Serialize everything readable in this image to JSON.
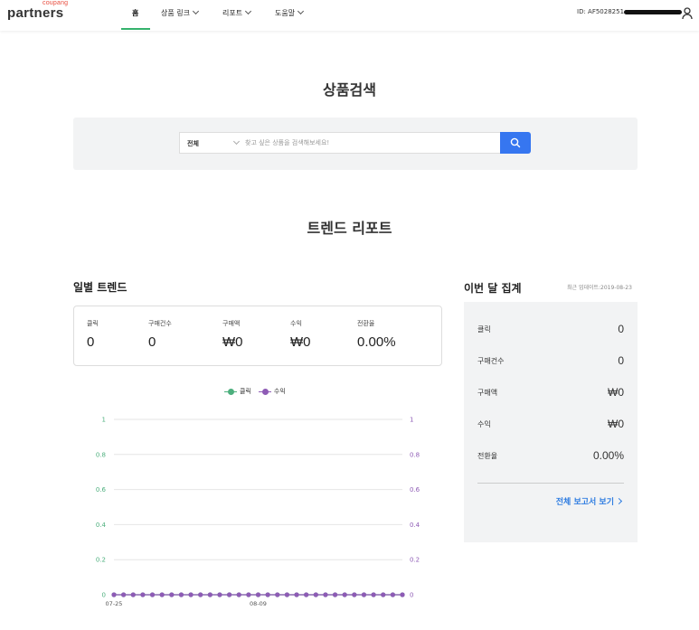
{
  "header": {
    "logo_small": "coupang",
    "logo_main": "partners",
    "nav": [
      {
        "label": "홈"
      },
      {
        "label": "상품 링크"
      },
      {
        "label": "리포트"
      },
      {
        "label": "도움말"
      }
    ],
    "user_id": "ID: AF5028251"
  },
  "search_section": {
    "title": "상품검색",
    "category": "전체",
    "placeholder": "찾고 싶은 상품을 검색해보세요!"
  },
  "trend_section": {
    "title": "트렌드 리포트"
  },
  "daily": {
    "title": "일별 트렌드",
    "stats": [
      {
        "label": "클릭",
        "value": "0"
      },
      {
        "label": "구매건수",
        "value": "0"
      },
      {
        "label": "구매액",
        "value": "₩0"
      },
      {
        "label": "수익",
        "value": "₩0"
      },
      {
        "label": "전환율",
        "value": "0.00%"
      }
    ]
  },
  "monthly": {
    "title": "이번 달 집계",
    "updated": "최근 업데이트:2019-08-23",
    "rows": [
      {
        "label": "클릭",
        "value": "0"
      },
      {
        "label": "구매건수",
        "value": "0"
      },
      {
        "label": "구매액",
        "value": "₩0"
      },
      {
        "label": "수익",
        "value": "₩0"
      },
      {
        "label": "전환율",
        "value": "0.00%"
      }
    ],
    "link": "전체 보고서 보기"
  },
  "chart_data": {
    "type": "line",
    "legend": [
      "클릭",
      "수익"
    ],
    "legend_placement": "top-center",
    "colors": {
      "클릭": "#4caf7d",
      "수익": "#8e5bb5"
    },
    "y_left_ticks": [
      "0",
      "0.2",
      "0.4",
      "0.6",
      "0.8",
      "1"
    ],
    "y_right_ticks": [
      "0",
      "0.2",
      "0.4",
      "0.6",
      "0.8",
      "1"
    ],
    "ylim": [
      0,
      1
    ],
    "x_tick_labels": [
      "07-25",
      "08-09"
    ],
    "x_tick_index": [
      0,
      15
    ],
    "grid": true,
    "series": [
      {
        "name": "클릭",
        "values": [
          0,
          0,
          0,
          0,
          0,
          0,
          0,
          0,
          0,
          0,
          0,
          0,
          0,
          0,
          0,
          0,
          0,
          0,
          0,
          0,
          0,
          0,
          0,
          0,
          0,
          0,
          0,
          0,
          0,
          0,
          0
        ]
      },
      {
        "name": "수익",
        "values": [
          0,
          0,
          0,
          0,
          0,
          0,
          0,
          0,
          0,
          0,
          0,
          0,
          0,
          0,
          0,
          0,
          0,
          0,
          0,
          0,
          0,
          0,
          0,
          0,
          0,
          0,
          0,
          0,
          0,
          0,
          0
        ]
      }
    ]
  }
}
